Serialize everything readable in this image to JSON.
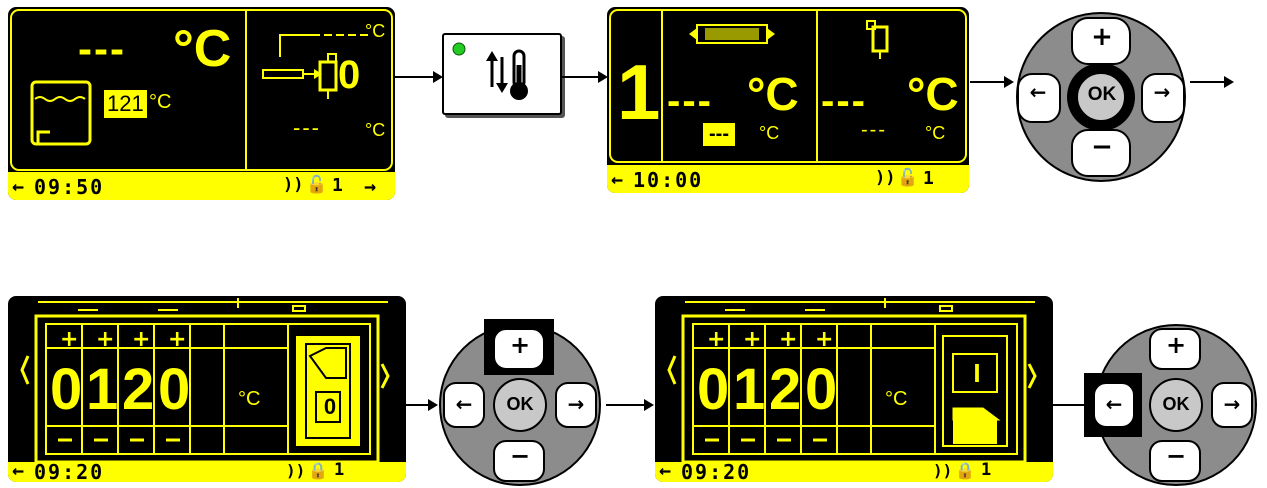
{
  "screen1": {
    "main_temp_dashes": "---",
    "main_temp_unit": "°C",
    "setpoint": "121",
    "setpoint_unit": "°C",
    "top_right_unit": "°C",
    "counter": "0",
    "bottom_right_dashes": "---",
    "bottom_right_unit": "°C",
    "time": "09:50",
    "lock_number": "1"
  },
  "panel_button": {
    "led_color": "#22cc22"
  },
  "screen2": {
    "program_number": "1",
    "temp1_dashes": "---",
    "temp1_unit": "°C",
    "sub_dashes": "---",
    "sub_unit": "°C",
    "temp2_dashes": "---",
    "temp2_unit": "°C",
    "sub2_dashes": "---",
    "sub2_unit": "°C",
    "time": "10:00",
    "lock_number": "1"
  },
  "keypad": {
    "ok_label": "OK",
    "plus_label": "+",
    "minus_label": "−",
    "left_label": "←",
    "right_label": "→"
  },
  "screen3": {
    "digits": [
      "0",
      "1",
      "2",
      "0"
    ],
    "unit": "°C",
    "switch_label": "0",
    "time": "09:20",
    "lock_number": "1"
  },
  "screen4": {
    "digits": [
      "0",
      "1",
      "2",
      "0"
    ],
    "unit": "°C",
    "switch_label": "I",
    "time": "09:20",
    "lock_number": "1"
  },
  "colors": {
    "lcd_yellow": "#ffff00",
    "lcd_black": "#000000",
    "keypad_gray": "#8c8c8c",
    "ok_gray": "#c8c8c8"
  }
}
